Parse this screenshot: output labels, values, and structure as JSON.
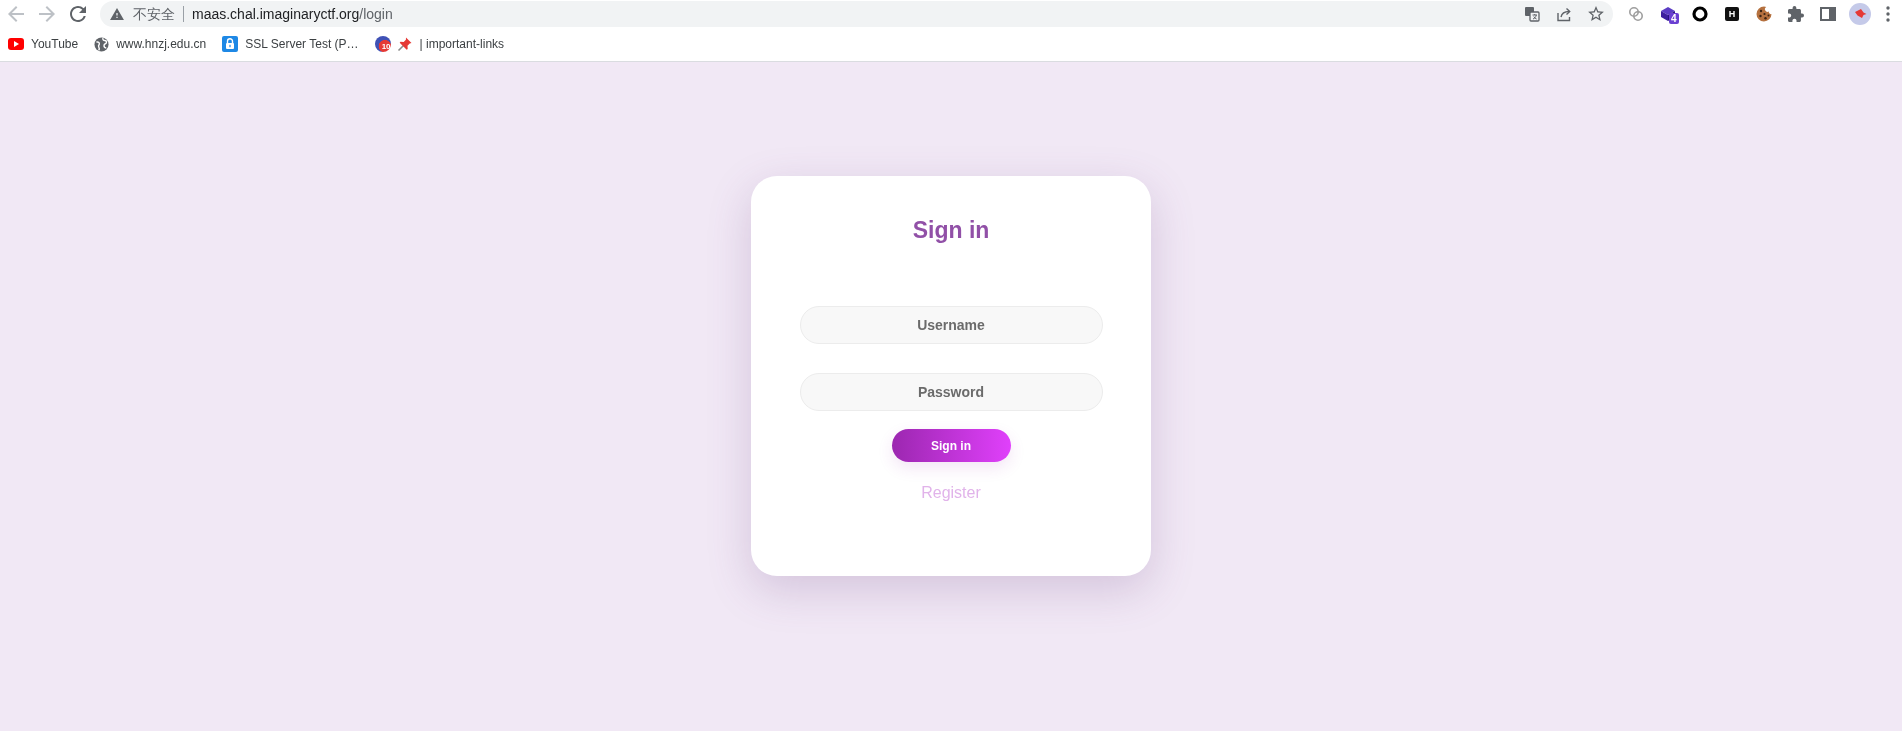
{
  "browser": {
    "nav_buttons": [
      {
        "kind": "back",
        "disabled": true
      },
      {
        "kind": "forward",
        "disabled": true
      },
      {
        "kind": "reload",
        "disabled": false
      }
    ],
    "address_bar": {
      "security_label": "不安全",
      "host": "maas.chal.imaginaryctf.org",
      "path": "/login"
    },
    "extension_badge": "4",
    "extension_letter": "H"
  },
  "bookmarks": [
    {
      "kind": "video",
      "title": "YouTube"
    },
    {
      "kind": "globe",
      "title": "www.hnzj.edu.cn"
    },
    {
      "kind": "lock",
      "title": "SSL Server Test (P…"
    },
    {
      "kind": "counter",
      "badge": "10",
      "title": "| important-links"
    }
  ],
  "login": {
    "title": "Sign in",
    "fields": [
      {
        "placeholder": "Username"
      },
      {
        "placeholder": "Password"
      }
    ],
    "submit": "Sign in",
    "link": "Register"
  }
}
